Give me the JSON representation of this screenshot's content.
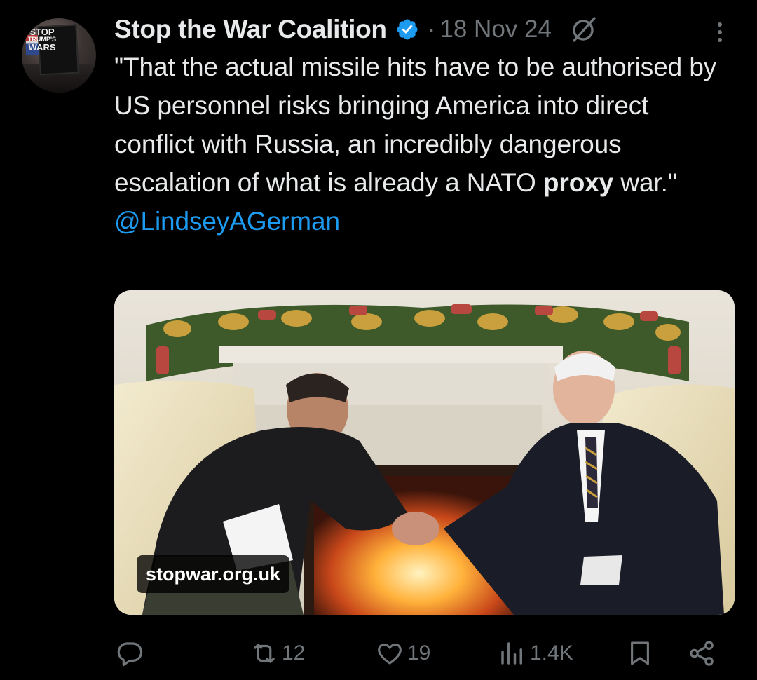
{
  "tweet": {
    "author_name": "Stop the War Coalition",
    "separator": "·",
    "date": "18 Nov 24",
    "avatar_sign": [
      "STOP",
      "TRUMP'S",
      "WARS"
    ],
    "text_before": "\"That the actual missile hits have to be authorised by US personnel risks bringing America into direct conflict with Russia, an incredibly dangerous escalation of what is already a NATO ",
    "text_bold": "proxy",
    "text_after": " war.\"",
    "mention": "@LindseyAGerman",
    "link_domain": "stopwar.org.uk"
  },
  "actions": {
    "reply_count": "",
    "retweet_count": "12",
    "like_count": "19",
    "views_count": "1.4K"
  },
  "colors": {
    "background": "#000000",
    "text_primary": "#e7e9ea",
    "text_secondary": "#71767b",
    "accent": "#1d9bf0"
  },
  "icons": [
    "verified-badge-icon",
    "grok-slash-icon",
    "more-dots-icon",
    "reply-icon",
    "retweet-icon",
    "like-icon",
    "views-icon",
    "bookmark-icon",
    "share-icon"
  ]
}
